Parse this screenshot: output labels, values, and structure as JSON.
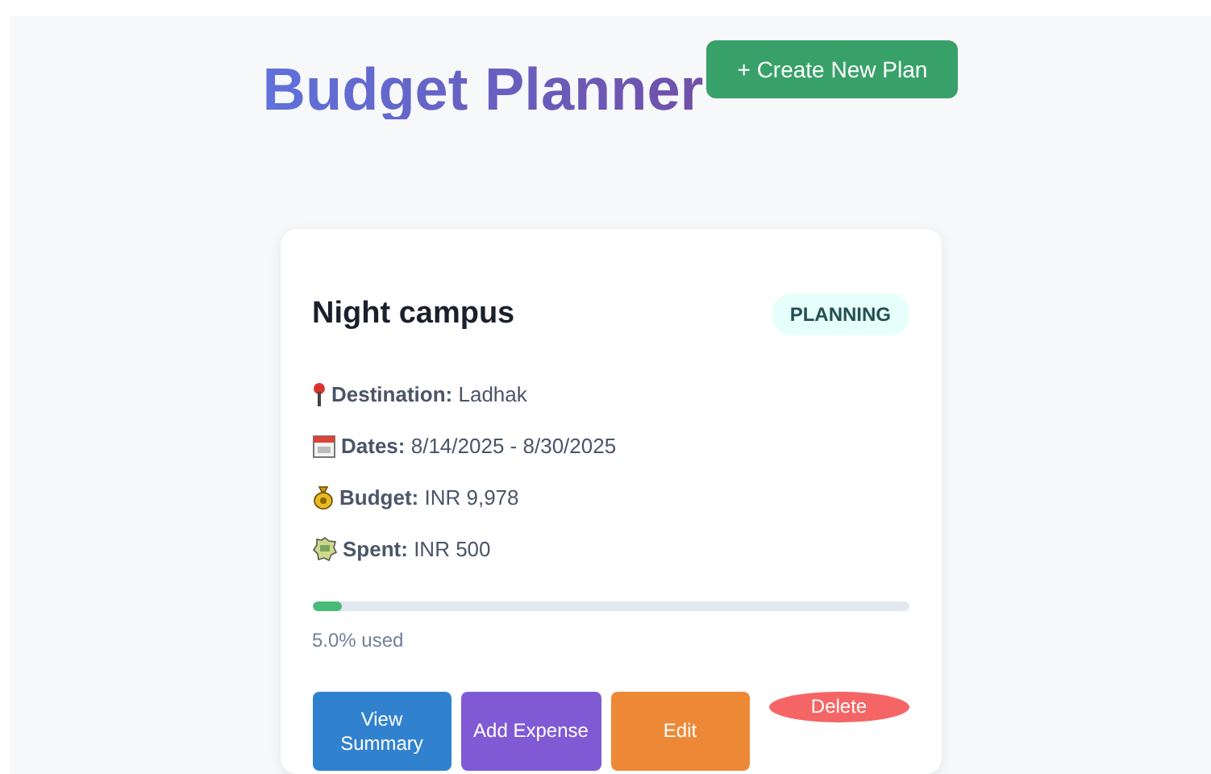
{
  "header": {
    "title": "Budget Planner",
    "create_button": "+ Create New Plan"
  },
  "plan": {
    "name": "Night campus",
    "status": "PLANNING",
    "details": [
      {
        "kind": "pin",
        "text": "**Destination:** Ladhak"
      },
      {
        "kind": "calendar",
        "text": "**Dates:** 8/14/2025 - 8/30/2025"
      },
      {
        "kind": "moneybag",
        "text": "**Budget:** INR 9,978"
      },
      {
        "kind": "badge",
        "text": "**Spent:** INR 500"
      }
    ],
    "progress": {
      "level": 0.05,
      "label": "5.0% used"
    },
    "actions": [
      {
        "kind": "view",
        "label": "View Summary"
      },
      {
        "kind": "add",
        "label": "Add Expense"
      },
      {
        "kind": "edit",
        "label": "Edit"
      },
      {
        "kind": "delete",
        "label": "Delete"
      }
    ]
  }
}
